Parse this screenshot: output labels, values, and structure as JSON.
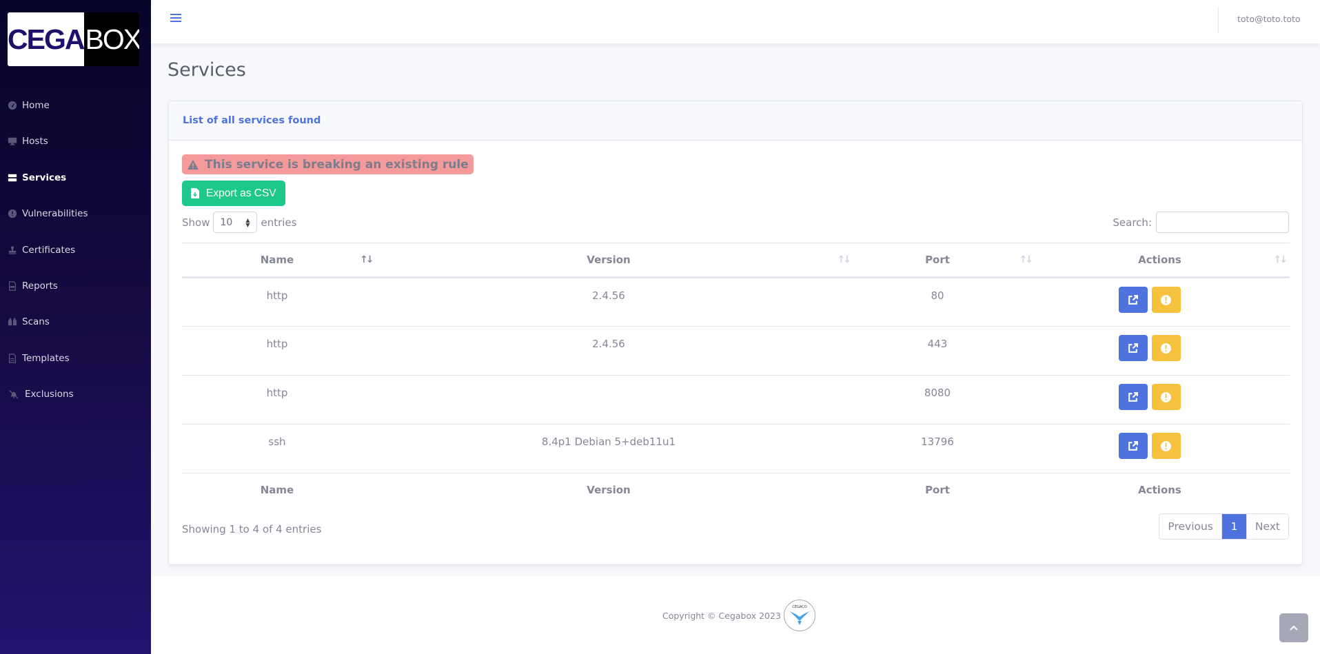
{
  "brand": {
    "part1": "CEGA",
    "part2": "BOX"
  },
  "sidebar": {
    "items": [
      {
        "label": "Home",
        "icon": "tachometer-icon",
        "active": false
      },
      {
        "label": "Hosts",
        "icon": "desktop-icon",
        "active": false
      },
      {
        "label": "Services",
        "icon": "server-icon",
        "active": true
      },
      {
        "label": "Vulnerabilities",
        "icon": "exclamation-circle-icon",
        "active": false
      },
      {
        "label": "Certificates",
        "icon": "stamp-icon",
        "active": false
      },
      {
        "label": "Reports",
        "icon": "file-pdf-icon",
        "active": false
      },
      {
        "label": "Scans",
        "icon": "binoculars-icon",
        "active": false
      },
      {
        "label": "Templates",
        "icon": "file-alt-icon",
        "active": false
      },
      {
        "label": "Exclusions",
        "icon": "bell-slash-icon",
        "active": false
      }
    ]
  },
  "topbar": {
    "user_email": "toto@toto.toto"
  },
  "page": {
    "title": "Services"
  },
  "card": {
    "header": "List of all services found",
    "alert_text": "This service is breaking an existing rule",
    "export_label": "Export as CSV",
    "show_label": "Show",
    "entries_label": "entries",
    "page_length": "10",
    "search_label": "Search:",
    "search_value": "",
    "info": "Showing 1 to 4 of 4 entries"
  },
  "table": {
    "columns": [
      "Name",
      "Version",
      "Port",
      "Actions"
    ],
    "rows": [
      {
        "name": "http",
        "version": "2.4.56",
        "port": "80"
      },
      {
        "name": "http",
        "version": "2.4.56",
        "port": "443"
      },
      {
        "name": "http",
        "version": "",
        "port": "8080"
      },
      {
        "name": "ssh",
        "version": "8.4p1 Debian 5+deb11u1",
        "port": "13796"
      }
    ]
  },
  "pagination": {
    "previous": "Previous",
    "current": "1",
    "next": "Next"
  },
  "footer": {
    "copyright": "Copyright © Cegabox 2023",
    "logo_text": "CEGACO"
  },
  "colors": {
    "primary": "#4e73df",
    "success": "#1cc88a",
    "warning": "#f6c23e",
    "danger_light": "#f59a9a",
    "sidebar_dark": "#07052a"
  }
}
